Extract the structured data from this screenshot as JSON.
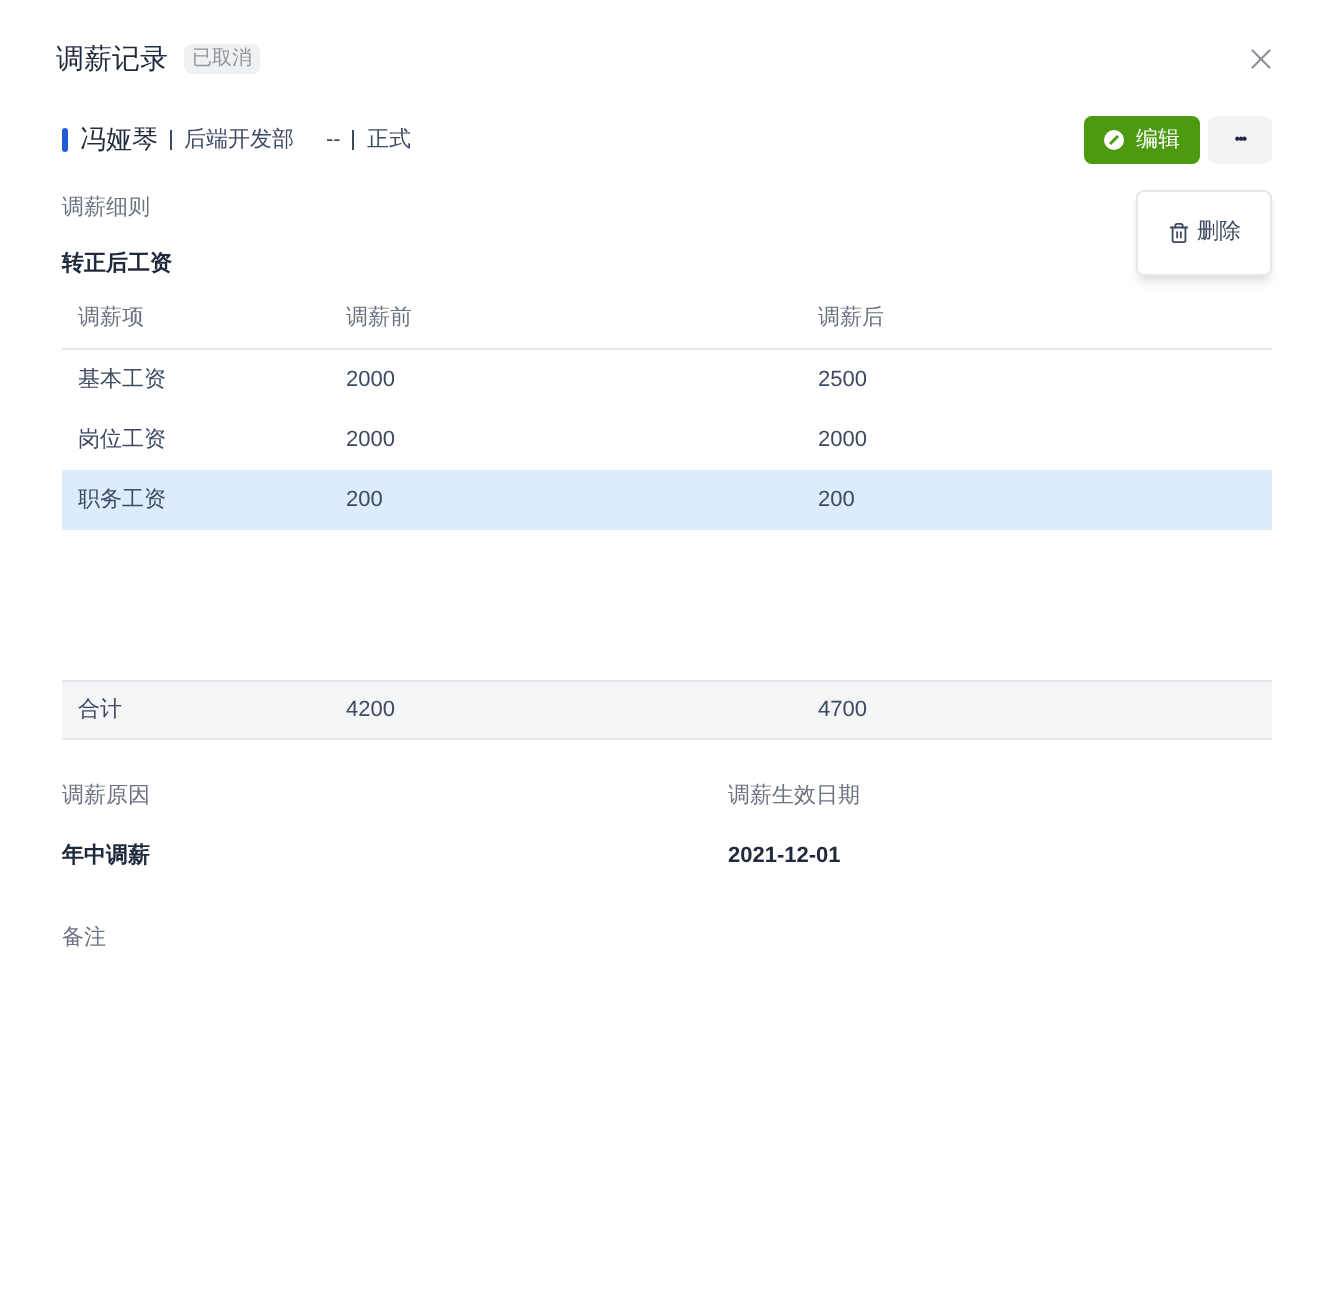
{
  "title": "调薪记录",
  "status_badge": "已取消",
  "employee": {
    "name": "冯娅琴",
    "department": "后端开发部",
    "position": "--",
    "employment_type": "正式"
  },
  "actions": {
    "edit": "编辑",
    "more": "•••"
  },
  "menu": [
    {
      "label": "删除"
    }
  ],
  "section_label": "调薪细则",
  "subsection": "转正后工资",
  "table": {
    "columns": [
      "调薪项",
      "调薪前",
      "调薪后"
    ],
    "rows": [
      {
        "cells": [
          "基本工资",
          "2000",
          "2500"
        ],
        "selected": false
      },
      {
        "cells": [
          "岗位工资",
          "2000",
          "2000"
        ],
        "selected": false
      },
      {
        "cells": [
          "职务工资",
          "200",
          "200"
        ],
        "selected": true
      }
    ],
    "total": [
      "合计",
      "4200",
      "4700"
    ]
  },
  "fields": [
    {
      "label": "调薪原因",
      "value": "年中调薪"
    },
    {
      "label": "调薪生效日期",
      "value": "2021-12-01"
    }
  ],
  "remark": {
    "label": "备注"
  }
}
